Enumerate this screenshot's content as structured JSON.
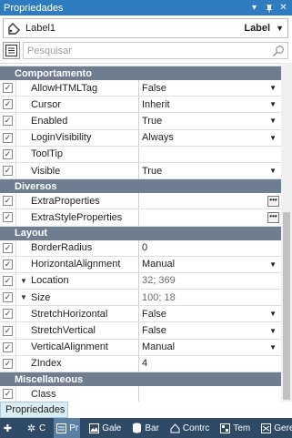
{
  "panel": {
    "title": "Propriedades"
  },
  "selector": {
    "object_name": "Label1",
    "object_type": "Label"
  },
  "search": {
    "placeholder": "Pesquisar"
  },
  "categories": {
    "behavior": "Comportamento",
    "misc": "Diversos",
    "layout": "Layout",
    "miscellaneous": "Miscellaneous"
  },
  "properties": {
    "allowhtmltag": {
      "name": "AllowHTMLTag",
      "value": "False"
    },
    "cursor": {
      "name": "Cursor",
      "value": "Inherit"
    },
    "enabled": {
      "name": "Enabled",
      "value": "True"
    },
    "loginvisibility": {
      "name": "LoginVisibility",
      "value": "Always"
    },
    "tooltip": {
      "name": "ToolTip",
      "value": ""
    },
    "visible": {
      "name": "Visible",
      "value": "True"
    },
    "extraproperties": {
      "name": "ExtraProperties",
      "value": ""
    },
    "extrastyleproperties": {
      "name": "ExtraStyleProperties",
      "value": ""
    },
    "borderradius": {
      "name": "BorderRadius",
      "value": "0"
    },
    "horizontalalignment": {
      "name": "HorizontalAlignment",
      "value": "Manual"
    },
    "location": {
      "name": "Location",
      "value": "32; 369"
    },
    "size": {
      "name": "Size",
      "value": "100; 18"
    },
    "stretchhorizontal": {
      "name": "StretchHorizontal",
      "value": "False"
    },
    "stretchvertical": {
      "name": "StretchVertical",
      "value": "False"
    },
    "verticalalignment": {
      "name": "VerticalAlignment",
      "value": "Manual"
    },
    "zindex": {
      "name": "ZIndex",
      "value": "4"
    },
    "class": {
      "name": "Class",
      "value": ""
    }
  },
  "bottom_tab": {
    "label": "Propriedades"
  },
  "taskbar": {
    "items": [
      {
        "label": "",
        "icon": "plus-icon"
      },
      {
        "label": "C",
        "icon": "gear-icon"
      },
      {
        "label": "Pr",
        "icon": "properties-icon"
      },
      {
        "label": "Gale",
        "icon": "gallery-icon"
      },
      {
        "label": "Bar",
        "icon": "database-icon"
      },
      {
        "label": "Contrc",
        "icon": "controls-icon"
      },
      {
        "label": "Tem",
        "icon": "template-icon"
      },
      {
        "label": "Geren",
        "icon": "manager-icon"
      }
    ]
  },
  "colors": {
    "titlebar": "#2f7bbf",
    "category_header": "#6e7d8f",
    "taskbar": "#2f4a66",
    "bottom_tab": "#d8eef2"
  }
}
